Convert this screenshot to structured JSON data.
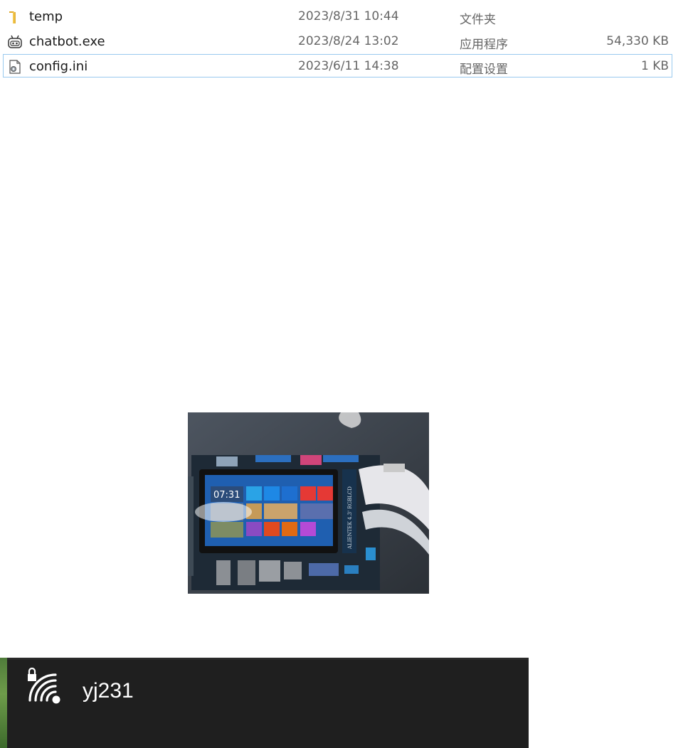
{
  "files": [
    {
      "name": "temp",
      "date": "2023/8/31 10:44",
      "type": "文件夹",
      "size": "",
      "icon": "folder-icon"
    },
    {
      "name": "chatbot.exe",
      "date": "2023/8/24 13:02",
      "type": "应用程序",
      "size": "54,330 KB",
      "icon": "robot-app-icon"
    },
    {
      "name": "config.ini",
      "date": "2023/6/11 14:38",
      "type": "配置设置",
      "size": "1 KB",
      "icon": "settings-file-icon"
    }
  ],
  "photo": {
    "clock_time": "07:31",
    "board_label": "ALIENTEK 4.3' RGBLCD"
  },
  "wifi": {
    "network_name": "yj231",
    "icon": "secured-wifi-icon"
  },
  "colors": {
    "selection_border": "#99c9ef",
    "folder": "#f3c74e",
    "panel_bg": "#1f1f1f"
  }
}
